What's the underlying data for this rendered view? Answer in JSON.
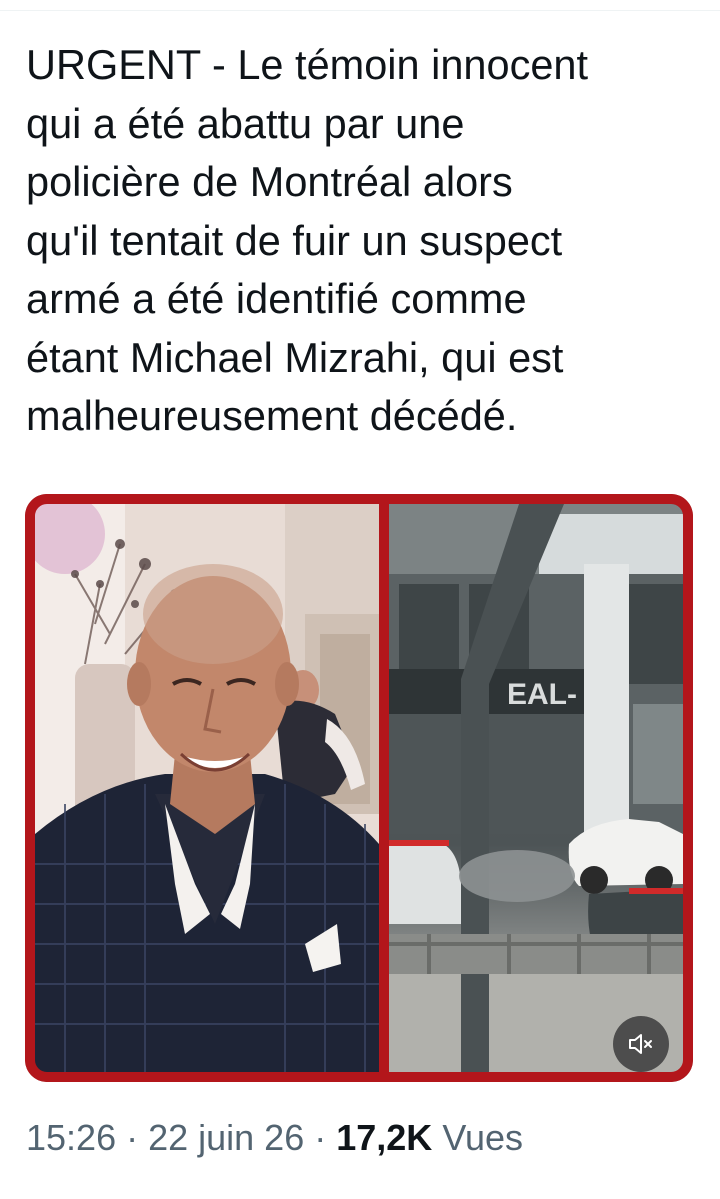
{
  "tweet": {
    "text": "URGENT - Le témoin innocent\nqui a été abattu par une\npolicière de Montréal alors\nqu'il tentait de fuir un suspect\narmé a été identifié comme\nétant Michael Mizrahi, qui est\nmalheureusement décédé."
  },
  "media": {
    "left_image": "portrait-photo",
    "right_image": "street-scene-video",
    "sign_text": "EAL-",
    "mute_icon": "speaker-muted-icon"
  },
  "meta": {
    "time": "15:26",
    "sep1": " · ",
    "date": "22 juin 26",
    "sep2": " · ",
    "views_count": "17,2K",
    "views_label": " Vues"
  },
  "colors": {
    "text": "#0f1419",
    "secondary": "#536471",
    "frame_red": "#b3161b"
  }
}
